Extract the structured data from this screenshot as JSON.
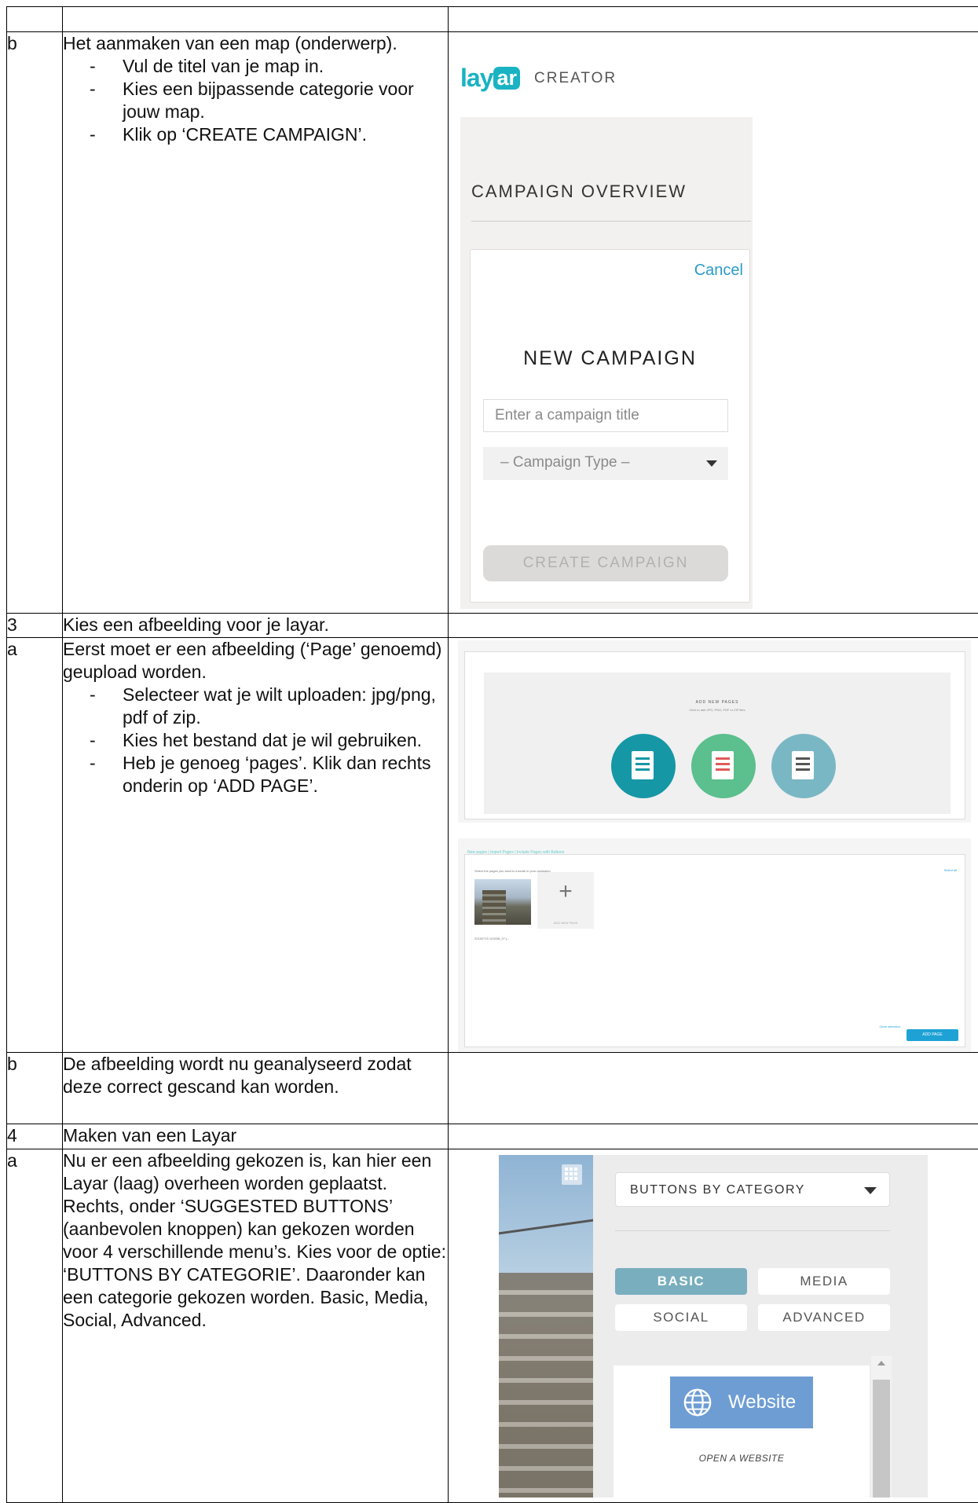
{
  "rows": [
    {
      "num": "",
      "text": ""
    },
    {
      "num": "b",
      "intro": "Het aanmaken van een map (onderwerp).",
      "bullets": [
        "Vul de titel van je map in.",
        "Kies een bijpassende categorie voor jouw map.",
        "Klik op ‘CREATE CAMPAIGN’."
      ]
    },
    {
      "num": "3",
      "text": "Kies een afbeelding voor je layar."
    },
    {
      "num": "a",
      "intro": "Eerst moet er een afbeelding (‘Page’ genoemd) geupload worden.",
      "bullets": [
        "Selecteer wat je wilt uploaden: jpg/png, pdf of zip.",
        "Kies het bestand dat je wil gebruiken.",
        "Heb je genoeg ‘pages’. Klik dan rechts onderin op ‘ADD PAGE’."
      ]
    },
    {
      "num": "b",
      "text": "De afbeelding wordt nu geanalyseerd zodat deze correct gescand kan worden."
    },
    {
      "num": "4",
      "text": "Maken van een Layar"
    },
    {
      "num": "a",
      "text": "Nu er een afbeelding gekozen is, kan hier een Layar (laag) overheen worden geplaatst. Rechts, onder ‘SUGGESTED BUTTONS’ (aanbevolen knoppen) kan gekozen worden voor 4 verschillende menu’s. Kies voor de optie: ‘BUTTONS BY CATEGORIE’. Daaronder kan een categorie gekozen worden. Basic, Media, Social, Advanced."
    }
  ],
  "layar": {
    "logo_lay": "lay",
    "logo_ar": "ar",
    "logo_creator": "CREATOR",
    "overview_title": "CAMPAIGN OVERVIEW",
    "cancel": "Cancel",
    "new_campaign": "NEW CAMPAIGN",
    "title_placeholder": "Enter a campaign title",
    "type_placeholder": "– Campaign Type –",
    "create_button": "CREATE CAMPAIGN",
    "brand_color": "#19b3c3"
  },
  "upload": {
    "crumb": "New pages  |  Import Pages  |  Include Pages with Buttons",
    "label": "ADD NEW PAGES",
    "sublabel": "Click to add JPG, PNG, PDF or ZIP files",
    "circle_colors": [
      "#1597a6",
      "#5bbf8e",
      "#7ab7c4"
    ],
    "icon_names": [
      "image-file-icon",
      "pdf-file-icon",
      "zip-file-icon"
    ]
  },
  "pages": {
    "crumb": "New pages  |  Import Pages  |  Include Pages with Buttons",
    "instruction": "Select the pages you want to include in your campaign",
    "select_all": "Select all",
    "thumb_caption": "20150715 103038_07.j...",
    "add_new": "ADD NEW PAGE",
    "clear": "Clear selection",
    "add_page": "ADD PAGE"
  },
  "buttons": {
    "dropdown": "BUTTONS BY CATEGORY",
    "categories": [
      {
        "label": "BASIC",
        "active": true
      },
      {
        "label": "MEDIA",
        "active": false
      },
      {
        "label": "SOCIAL",
        "active": false
      },
      {
        "label": "ADVANCED",
        "active": false
      }
    ],
    "website_label": "Website",
    "website_desc": "OPEN A WEBSITE",
    "accent": "#79aebe"
  }
}
